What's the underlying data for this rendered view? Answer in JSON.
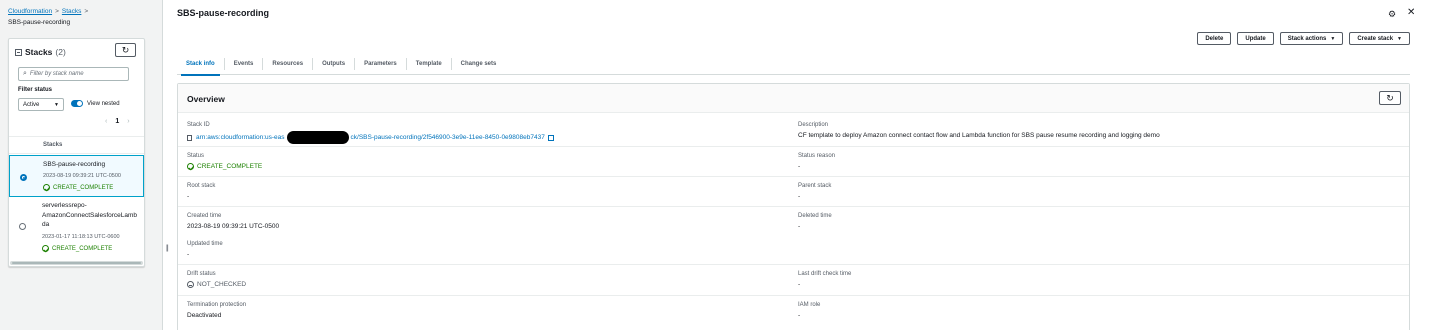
{
  "breadcrumb": {
    "items": [
      "Cloudformation",
      "Stacks"
    ],
    "current": "SBS-pause-recording"
  },
  "sidebar": {
    "title": "Stacks",
    "count": "(2)",
    "search_placeholder": "Filter by stack name",
    "filter_status_label": "Filter status",
    "filter_status_value": "Active",
    "view_nested_label": "View nested",
    "page": "1",
    "column_header": "Stacks",
    "rows": [
      {
        "name": "SBS-pause-recording",
        "date": "2023-08-19 09:39:21 UTC-0500",
        "status": "CREATE_COMPLETE"
      },
      {
        "name_lines": [
          "serverlessrepo-",
          "AmazonConnectSalesforceLamb",
          "da"
        ],
        "date": "2023-01-17 11:18:13 UTC-0600",
        "status": "CREATE_COMPLETE"
      }
    ]
  },
  "main": {
    "title": "SBS-pause-recording",
    "actions": {
      "delete": "Delete",
      "update": "Update",
      "stack_actions": "Stack actions",
      "create_stack": "Create stack"
    },
    "tabs": [
      "Stack info",
      "Events",
      "Resources",
      "Outputs",
      "Parameters",
      "Template",
      "Change sets"
    ],
    "overview": {
      "title": "Overview",
      "stack_id_label": "Stack ID",
      "stack_id_prefix": "arn:aws:cloudformation:us-eas",
      "stack_id_suffix": "ck/SBS-pause-recording/2f546900-3e9e-11ee-8450-0e9808eb7437",
      "description_label": "Description",
      "description_value": "CF template to deploy Amazon connect contact flow and Lambda function for SBS pause resume recording and logging demo",
      "status_label": "Status",
      "status_value": "CREATE_COMPLETE",
      "status_reason_label": "Status reason",
      "status_reason_value": "-",
      "root_stack_label": "Root stack",
      "root_stack_value": "-",
      "parent_stack_label": "Parent stack",
      "parent_stack_value": "-",
      "created_time_label": "Created time",
      "created_time_value": "2023-08-19 09:39:21 UTC-0500",
      "deleted_time_label": "Deleted time",
      "deleted_time_value": "-",
      "updated_time_label": "Updated time",
      "updated_time_value": "-",
      "drift_status_label": "Drift status",
      "drift_status_value": "NOT_CHECKED",
      "last_drift_label": "Last drift check time",
      "last_drift_value": "-",
      "termination_label": "Termination protection",
      "termination_value": "Deactivated",
      "iam_role_label": "IAM role",
      "iam_role_value": "-"
    }
  },
  "colors": {
    "link": "#0073bb",
    "success": "#1d8102",
    "text": "#16191f",
    "muted": "#545b64"
  }
}
